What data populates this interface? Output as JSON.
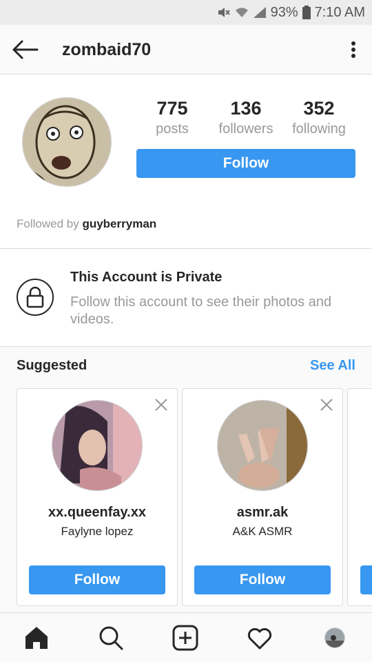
{
  "status_bar": {
    "battery": "93%",
    "time": "7:10 AM"
  },
  "header": {
    "username": "zombaid70"
  },
  "profile": {
    "stats": [
      {
        "value": "775",
        "label": "posts"
      },
      {
        "value": "136",
        "label": "followers"
      },
      {
        "value": "352",
        "label": "following"
      }
    ],
    "follow_label": "Follow",
    "followed_by_prefix": "Followed by",
    "followed_by_user": "guyberryman"
  },
  "private": {
    "title": "This Account is Private",
    "description": "Follow this account to see their photos and videos."
  },
  "suggested": {
    "title": "Suggested",
    "see_all": "See All",
    "cards": [
      {
        "username": "xx.queenfay.xx",
        "name": "Faylyne lopez",
        "follow_label": "Follow"
      },
      {
        "username": "asmr.ak",
        "name": "A&K ASMR",
        "follow_label": "Follow"
      }
    ]
  },
  "colors": {
    "accent": "#3897f0",
    "text": "#262626",
    "muted": "#999999"
  },
  "nav": [
    "home-icon",
    "search-icon",
    "add-post-icon",
    "activity-heart-icon",
    "profile-avatar"
  ]
}
